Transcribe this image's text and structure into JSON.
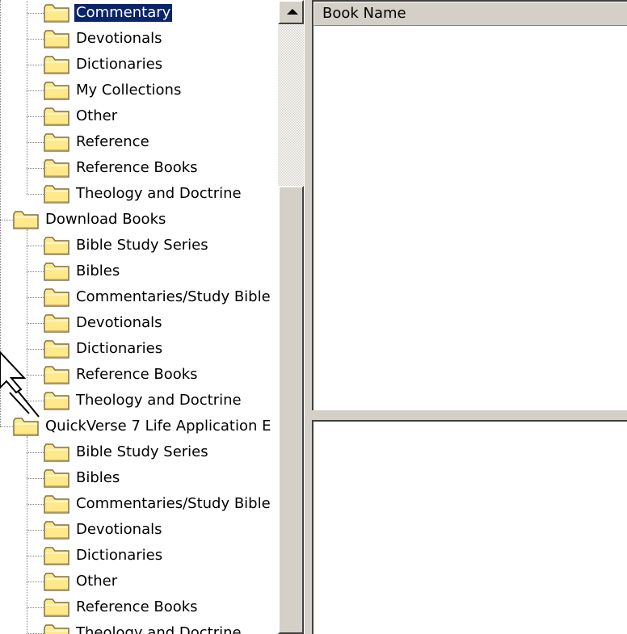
{
  "tree": {
    "items": [
      {
        "label": "Commentary",
        "level": 1,
        "selected": true
      },
      {
        "label": "Devotionals",
        "level": 1
      },
      {
        "label": "Dictionaries",
        "level": 1
      },
      {
        "label": "My Collections",
        "level": 1
      },
      {
        "label": "Other",
        "level": 1
      },
      {
        "label": "Reference",
        "level": 1
      },
      {
        "label": "Reference Books",
        "level": 1
      },
      {
        "label": "Theology and Doctrine",
        "level": 1
      },
      {
        "label": "Download Books",
        "level": 0
      },
      {
        "label": "Bible Study Series",
        "level": 1
      },
      {
        "label": "Bibles",
        "level": 1
      },
      {
        "label": "Commentaries/Study Bible",
        "level": 1
      },
      {
        "label": "Devotionals",
        "level": 1
      },
      {
        "label": "Dictionaries",
        "level": 1
      },
      {
        "label": "Reference Books",
        "level": 1
      },
      {
        "label": "Theology and Doctrine",
        "level": 1
      },
      {
        "label": "QuickVerse 7 Life Application E",
        "level": 0
      },
      {
        "label": "Bible Study Series",
        "level": 1
      },
      {
        "label": "Bibles",
        "level": 1
      },
      {
        "label": "Commentaries/Study Bible",
        "level": 1
      },
      {
        "label": "Devotionals",
        "level": 1
      },
      {
        "label": "Dictionaries",
        "level": 1
      },
      {
        "label": "Other",
        "level": 1
      },
      {
        "label": "Reference Books",
        "level": 1
      },
      {
        "label": "Theology and Doctrine",
        "level": 1
      }
    ]
  },
  "list": {
    "columns": [
      "Book Name"
    ]
  },
  "icons": {
    "folder": "folder-icon",
    "scroll_up": "scroll-up-arrow-icon",
    "cursor": "mouse-pointer-icon"
  },
  "colors": {
    "selection": "#0a246a",
    "folder_fill": "#ffe98a",
    "chrome": "#d4d0c8"
  }
}
